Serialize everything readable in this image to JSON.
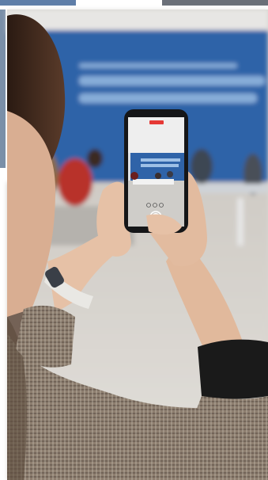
{
  "photo": {
    "subject": "person-filming-event-with-smartphone",
    "palette": {
      "page_white": "#ffffff",
      "backdrop_blue": "#2f63a8",
      "banner_text": "#9ec0e6",
      "floor": "#d7d4cf",
      "red_shirt": "#b8332a",
      "hair": "#3a261c",
      "skin": "#e6c1a6",
      "phone_black": "#151618",
      "jacket_check": "#8a7a6a",
      "cuff_black": "#1a1a1a",
      "watch_band": "#e9e8e4"
    }
  }
}
